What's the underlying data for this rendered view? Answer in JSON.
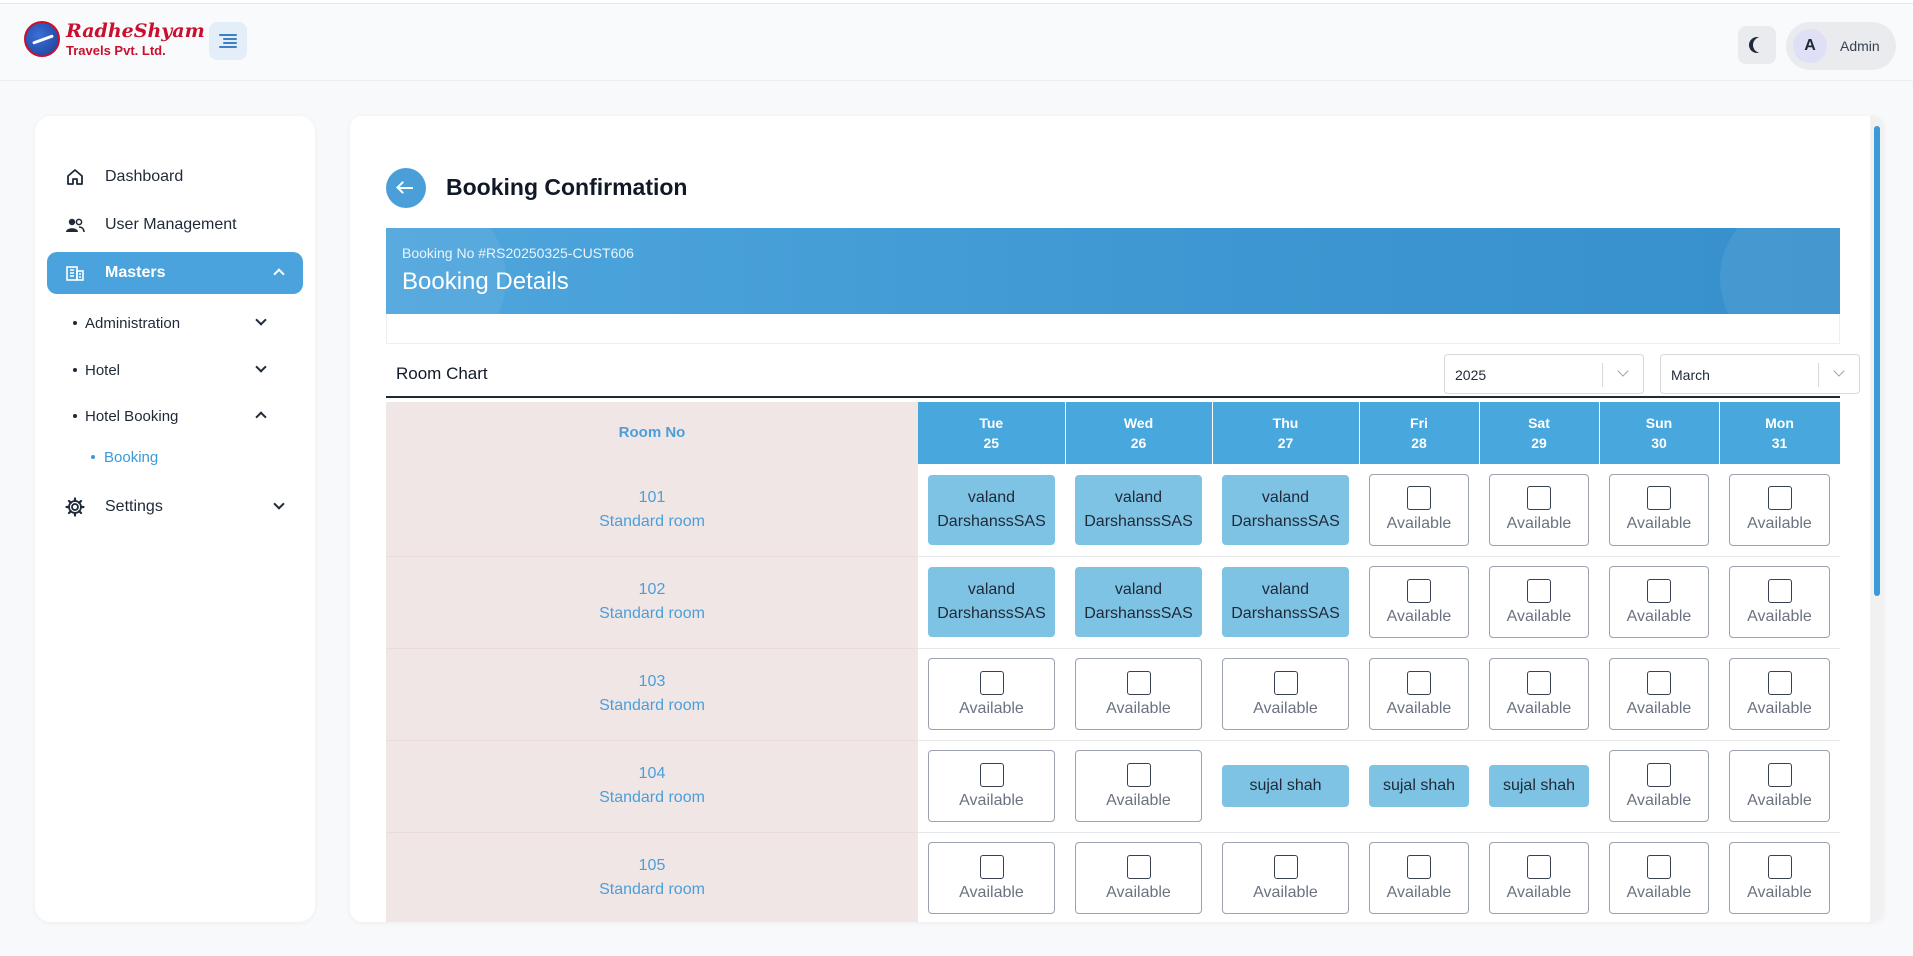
{
  "header": {
    "logo": {
      "name": "RadheShyam",
      "subtitle": "Travels Pvt. Ltd."
    },
    "menu_toggle_icon": "menu-icon",
    "theme_icon": "moon-icon",
    "user": {
      "initial": "A",
      "name": "Admin"
    }
  },
  "sidebar": {
    "items": [
      {
        "label": "Dashboard",
        "icon": "home-icon"
      },
      {
        "label": "User Management",
        "icon": "users-icon"
      },
      {
        "label": "Masters",
        "icon": "building-icon",
        "active": true
      },
      {
        "label": "Settings",
        "icon": "gear-icon"
      }
    ],
    "sub_items": [
      {
        "label": "Administration"
      },
      {
        "label": "Hotel"
      },
      {
        "label": "Hotel Booking"
      },
      {
        "label": "Booking"
      }
    ]
  },
  "page": {
    "title": "Booking Confirmation",
    "booking_no": "Booking No #RS20250325-CUST606",
    "details_title": "Booking Details"
  },
  "room_chart": {
    "title": "Room Chart",
    "year": "2025",
    "month": "March",
    "room_header": "Room No",
    "days": [
      {
        "dow": "Tue",
        "date": "25"
      },
      {
        "dow": "Wed",
        "date": "26"
      },
      {
        "dow": "Thu",
        "date": "27"
      },
      {
        "dow": "Fri",
        "date": "28"
      },
      {
        "dow": "Sat",
        "date": "29"
      },
      {
        "dow": "Sun",
        "date": "30"
      },
      {
        "dow": "Mon",
        "date": "31"
      }
    ],
    "available_label": "Available",
    "rooms": [
      {
        "no": "101",
        "type": "Standard room",
        "cells": [
          "valand DarshanssSAS",
          "valand DarshanssSAS",
          "valand DarshanssSAS",
          null,
          null,
          null,
          null
        ]
      },
      {
        "no": "102",
        "type": "Standard room",
        "cells": [
          "valand DarshanssSAS",
          "valand DarshanssSAS",
          "valand DarshanssSAS",
          null,
          null,
          null,
          null
        ]
      },
      {
        "no": "103",
        "type": "Standard room",
        "cells": [
          null,
          null,
          null,
          null,
          null,
          null,
          null
        ]
      },
      {
        "no": "104",
        "type": "Standard room",
        "cells": [
          null,
          null,
          "sujal shah",
          "sujal shah",
          "sujal shah",
          null,
          null
        ]
      },
      {
        "no": "105",
        "type": "Standard room",
        "cells": [
          null,
          null,
          null,
          null,
          null,
          null,
          null
        ]
      }
    ]
  },
  "colors": {
    "accent": "#4aa3dd",
    "booked": "#7ec3e3",
    "room_bg": "#f1e6e6",
    "brand": "#c8102e"
  }
}
